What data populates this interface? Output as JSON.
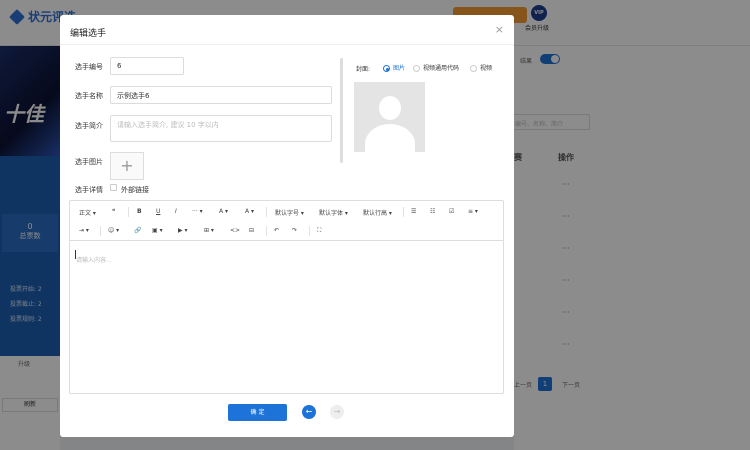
{
  "app": {
    "logo_text": "状元评选",
    "vip_badge": "VIP",
    "vip_label": "会员升级",
    "orange_button": ""
  },
  "background": {
    "banner_text": "十佳",
    "stat_value": "0",
    "stat_label": "总票数",
    "info_lines": [
      "投票开始: 2",
      "投票截止: 2",
      "投票规则: 2"
    ],
    "upgrade_label": "升级",
    "refresh_label": "刷新",
    "right_header_a": "赛",
    "right_header_b": "操作",
    "right_search_placeholder": "编号、名称、简介",
    "row_action": "···",
    "pager_prev": "上一页",
    "pager_current": "1",
    "pager_next": "下一页",
    "toggle_label": "结果"
  },
  "modal": {
    "title": "编辑选手",
    "close": "×",
    "fields": {
      "number_label": "选手编号",
      "number_value": "6",
      "name_label": "选手名称",
      "name_value": "示例选手6",
      "intro_label": "选手简介",
      "intro_placeholder": "请输入选手简介, 建议 10 字以内",
      "image_label": "选手图片",
      "image_plus": "+",
      "detail_label": "选手详情",
      "external_link_label": "外部链接"
    },
    "cover": {
      "label": "封面:",
      "options": [
        "图片",
        "视频通用代码",
        "视频"
      ],
      "selected": "图片"
    },
    "editor": {
      "toolbar_row1": [
        "正文 ▾",
        "❝",
        "B",
        "U",
        "I",
        "··· ▾",
        "A ▾",
        "A ▾",
        "默认字号 ▾",
        "默认字体 ▾",
        "默认行高 ▾",
        "☰",
        "☷",
        "☑",
        "≡ ▾"
      ],
      "toolbar_row2": [
        "⇥ ▾",
        "☺ ▾",
        "🔗",
        "▣ ▾",
        "▶ ▾",
        "⊞ ▾",
        "<>",
        "⊟",
        "↶",
        "↷",
        "⛶"
      ],
      "placeholder": "请输入内容..."
    },
    "ok_button": "确 定",
    "prev_icon": "←",
    "next_icon": "→"
  }
}
